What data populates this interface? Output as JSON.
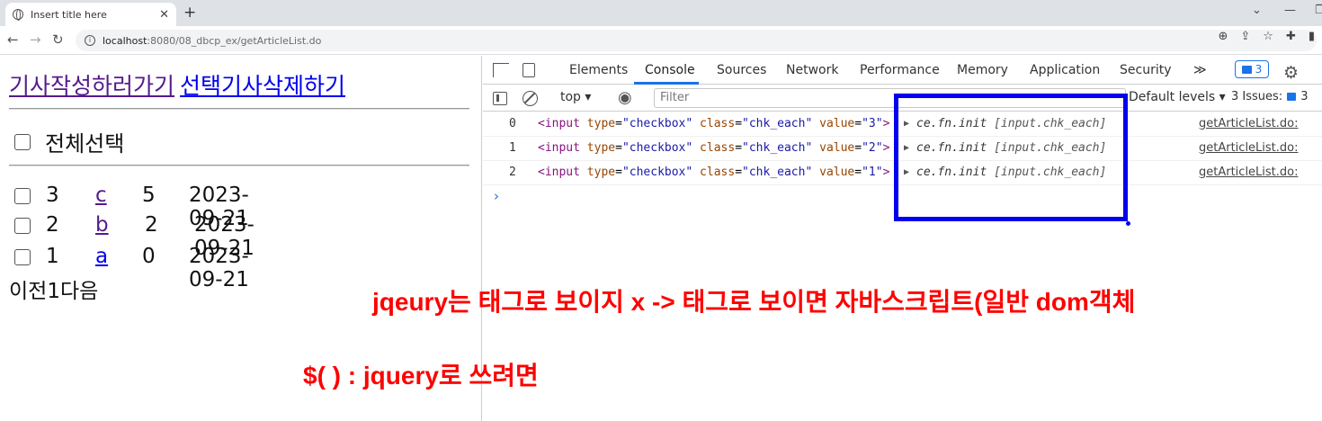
{
  "browser": {
    "tab_title": "Insert title here",
    "tab_close": "✕",
    "new_tab": "+",
    "min_btn": "—",
    "url_host": "localhost",
    "url_rest": ":8080/08_dbcp_ex/getArticleList.do",
    "nav": {
      "back": "←",
      "forward": "→",
      "reload": "↻"
    }
  },
  "page": {
    "link_write": "기사작성하러가기",
    "link_delete": "선택기사삭제하기",
    "select_all": "전체선택",
    "rows": [
      {
        "num": "3",
        "title": "c",
        "count": "5",
        "date": "2023-09-21"
      },
      {
        "num": "2",
        "title": "b",
        "count": "2",
        "date": "2023-09-21"
      },
      {
        "num": "1",
        "title": "a",
        "count": "0",
        "date": "2023-09-21"
      }
    ],
    "pager": "이전1다음"
  },
  "devtools": {
    "tabs": [
      "Elements",
      "Console",
      "Sources",
      "Network",
      "Performance",
      "Memory",
      "Application",
      "Security"
    ],
    "active_tab": "Console",
    "more_tabs": "≫",
    "messages_count": "3",
    "context": "top ▾",
    "filter_placeholder": "Filter",
    "default_levels": "Default levels ▾",
    "issues_label": "3 Issues:",
    "issues_count": "3",
    "console_rows": [
      {
        "index": "0",
        "tag_open": "<input",
        "type_attr": "type",
        "type_val": "\"checkbox\"",
        "class_attr": "class",
        "class_val": "\"chk_each\"",
        "value_attr": "value",
        "value_val": "\"3\"",
        "tag_close": ">",
        "object": "ce.fn.init",
        "object_detail": "[input.chk_each]",
        "source": "getArticleList.do:"
      },
      {
        "index": "1",
        "tag_open": "<input",
        "type_attr": "type",
        "type_val": "\"checkbox\"",
        "class_attr": "class",
        "class_val": "\"chk_each\"",
        "value_attr": "value",
        "value_val": "\"2\"",
        "tag_close": ">",
        "object": "ce.fn.init",
        "object_detail": "[input.chk_each]",
        "source": "getArticleList.do:"
      },
      {
        "index": "2",
        "tag_open": "<input",
        "type_attr": "type",
        "type_val": "\"checkbox\"",
        "class_attr": "class",
        "class_val": "\"chk_each\"",
        "value_attr": "value",
        "value_val": "\"1\"",
        "tag_close": ">",
        "object": "ce.fn.init",
        "object_detail": "[input.chk_each]",
        "source": "getArticleList.do:"
      }
    ],
    "prompt": "›"
  },
  "annotations": {
    "note1": "jqeury는 태그로 보이지 x -> 태그로 보이면 자바스크립트(일반 dom객체",
    "note2": "$(     ) : jquery로 쓰려면"
  },
  "colors": {
    "annotation_red": "#ff0000",
    "highlight_blue": "#0000ee",
    "devtools_accent": "#1a73e8"
  }
}
